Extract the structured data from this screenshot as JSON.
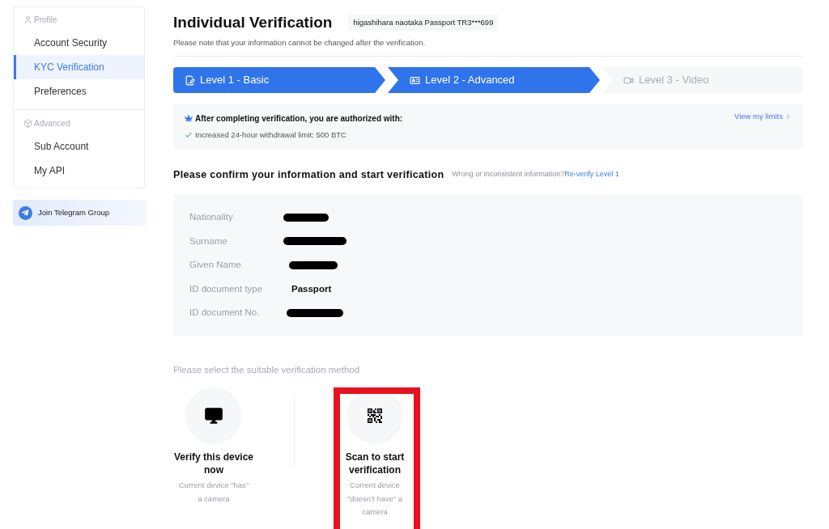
{
  "sidebar": {
    "groups": [
      {
        "title": "Profile",
        "items": [
          {
            "label": "Account Security",
            "selected": false
          },
          {
            "label": "KYC Verification",
            "selected": true
          },
          {
            "label": "Preferences",
            "selected": false
          }
        ]
      },
      {
        "title": "Advanced",
        "items": [
          {
            "label": "Sub Account",
            "selected": false
          },
          {
            "label": "My API",
            "selected": false
          }
        ]
      }
    ],
    "community_button": "Join Telegram Group"
  },
  "header": {
    "title": "Individual Verification",
    "identity_tag": "higashihara naotaka Passport TR3***699",
    "note": "Please note that your information cannot be changed after the verification."
  },
  "steps": [
    {
      "label": "Level 1 - Basic",
      "active": true
    },
    {
      "label": "Level 2 - Advanced",
      "active": true
    },
    {
      "label": "Level 3 - Video",
      "active": false
    }
  ],
  "benefits": {
    "heading": "After completing verification, you are authorized with:",
    "items": [
      "Increased 24-hour withdrawal limit: 500 BTC"
    ],
    "link": "View my limits"
  },
  "confirm": {
    "heading": "Please confirm your information and start verification",
    "hint": "Wrong or inconsistent information?",
    "link": "Re-verify Level 1"
  },
  "fields": [
    {
      "label": "Nationality",
      "kind": "redacted"
    },
    {
      "label": "Surname",
      "kind": "redacted"
    },
    {
      "label": "Given Name",
      "kind": "redacted"
    },
    {
      "label": "ID document type",
      "kind": "text",
      "value": "Passport"
    },
    {
      "label": "ID document No.",
      "kind": "redacted"
    }
  ],
  "methods": {
    "prompt": "Please select the suitable verification method",
    "options": [
      {
        "title": "Verify this device now",
        "description": "Current device \"has\" a camera",
        "highlighted": false
      },
      {
        "title": "Scan to start verification",
        "description": "Current device \"doesn't have\" a camera",
        "highlighted": true
      }
    ]
  }
}
